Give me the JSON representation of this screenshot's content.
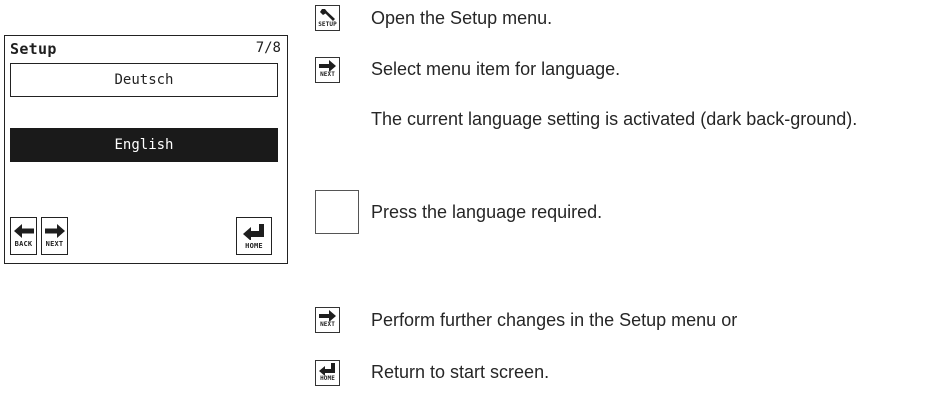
{
  "device": {
    "title": "Setup",
    "page_indicator": "7/8",
    "option_1": "Deutsch",
    "option_2": "English",
    "btn_back_label": "BACK",
    "btn_next_label": "NEXT",
    "btn_home_label": "HOME"
  },
  "steps": {
    "s1_icon_label": "SETUP",
    "s1_text": "Open the Setup menu.",
    "s2_icon_label": "NEXT",
    "s2_text": "Select menu item for language.",
    "s3_text": "The current language setting is activated (dark back-ground).",
    "s4_text": "Press the language required.",
    "s5_icon_label": "NEXT",
    "s5_text": "Perform further changes in the Setup menu or",
    "s6_icon_label": "HOME",
    "s6_text": "Return to start screen."
  },
  "colors": {
    "ink": "#1e1e1e",
    "selected_bg": "#1a1a1a",
    "selected_fg": "#ffffff"
  }
}
